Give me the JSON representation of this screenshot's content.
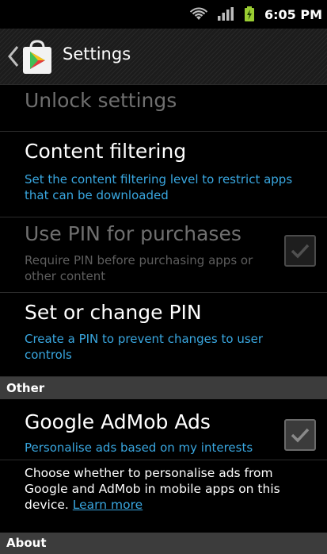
{
  "status_bar": {
    "time": "6:05 PM",
    "icons": [
      "wifi-icon",
      "signal-icon",
      "battery-charging-icon"
    ]
  },
  "action_bar": {
    "title": "Settings",
    "icons": [
      "back-chevron-icon",
      "play-store-icon"
    ]
  },
  "settings": {
    "unlock": {
      "title": "Unlock settings"
    },
    "content_filtering": {
      "title": "Content filtering",
      "subtitle": "Set the content filtering level to restrict apps that can be downloaded"
    },
    "use_pin": {
      "title": "Use PIN for purchases",
      "subtitle": "Require PIN before purchasing apps or other content",
      "checked": true,
      "enabled": false
    },
    "set_pin": {
      "title": "Set or change PIN",
      "subtitle": "Create a PIN to prevent changes to user controls"
    }
  },
  "sections": {
    "other": "Other",
    "about": "About"
  },
  "admob": {
    "title": "Google AdMob Ads",
    "subtitle": "Personalise ads based on my interests",
    "checked": true,
    "info_text": "Choose whether to personalise ads from Google and AdMob in mobile apps on this device.",
    "learn_more": "Learn more"
  },
  "colors": {
    "accent": "#39a7e0",
    "section_bg": "#3c3c3c",
    "background": "#000000"
  }
}
